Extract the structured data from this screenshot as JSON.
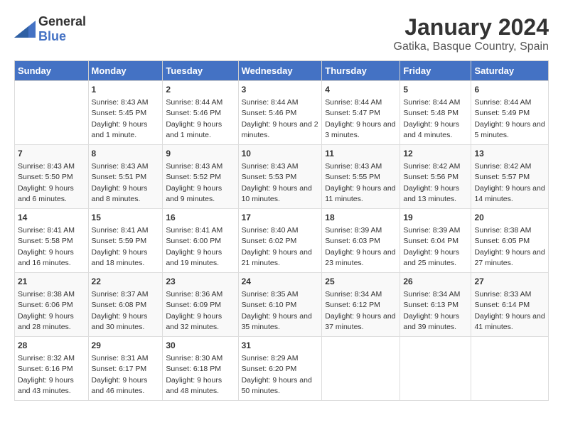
{
  "logo": {
    "general": "General",
    "blue": "Blue"
  },
  "title": "January 2024",
  "subtitle": "Gatika, Basque Country, Spain",
  "days_of_week": [
    "Sunday",
    "Monday",
    "Tuesday",
    "Wednesday",
    "Thursday",
    "Friday",
    "Saturday"
  ],
  "weeks": [
    [
      {
        "day": "",
        "sunrise": "",
        "sunset": "",
        "daylight": ""
      },
      {
        "day": "1",
        "sunrise": "Sunrise: 8:43 AM",
        "sunset": "Sunset: 5:45 PM",
        "daylight": "Daylight: 9 hours and 1 minute."
      },
      {
        "day": "2",
        "sunrise": "Sunrise: 8:44 AM",
        "sunset": "Sunset: 5:46 PM",
        "daylight": "Daylight: 9 hours and 1 minute."
      },
      {
        "day": "3",
        "sunrise": "Sunrise: 8:44 AM",
        "sunset": "Sunset: 5:46 PM",
        "daylight": "Daylight: 9 hours and 2 minutes."
      },
      {
        "day": "4",
        "sunrise": "Sunrise: 8:44 AM",
        "sunset": "Sunset: 5:47 PM",
        "daylight": "Daylight: 9 hours and 3 minutes."
      },
      {
        "day": "5",
        "sunrise": "Sunrise: 8:44 AM",
        "sunset": "Sunset: 5:48 PM",
        "daylight": "Daylight: 9 hours and 4 minutes."
      },
      {
        "day": "6",
        "sunrise": "Sunrise: 8:44 AM",
        "sunset": "Sunset: 5:49 PM",
        "daylight": "Daylight: 9 hours and 5 minutes."
      }
    ],
    [
      {
        "day": "7",
        "sunrise": "Sunrise: 8:43 AM",
        "sunset": "Sunset: 5:50 PM",
        "daylight": "Daylight: 9 hours and 6 minutes."
      },
      {
        "day": "8",
        "sunrise": "Sunrise: 8:43 AM",
        "sunset": "Sunset: 5:51 PM",
        "daylight": "Daylight: 9 hours and 8 minutes."
      },
      {
        "day": "9",
        "sunrise": "Sunrise: 8:43 AM",
        "sunset": "Sunset: 5:52 PM",
        "daylight": "Daylight: 9 hours and 9 minutes."
      },
      {
        "day": "10",
        "sunrise": "Sunrise: 8:43 AM",
        "sunset": "Sunset: 5:53 PM",
        "daylight": "Daylight: 9 hours and 10 minutes."
      },
      {
        "day": "11",
        "sunrise": "Sunrise: 8:43 AM",
        "sunset": "Sunset: 5:55 PM",
        "daylight": "Daylight: 9 hours and 11 minutes."
      },
      {
        "day": "12",
        "sunrise": "Sunrise: 8:42 AM",
        "sunset": "Sunset: 5:56 PM",
        "daylight": "Daylight: 9 hours and 13 minutes."
      },
      {
        "day": "13",
        "sunrise": "Sunrise: 8:42 AM",
        "sunset": "Sunset: 5:57 PM",
        "daylight": "Daylight: 9 hours and 14 minutes."
      }
    ],
    [
      {
        "day": "14",
        "sunrise": "Sunrise: 8:41 AM",
        "sunset": "Sunset: 5:58 PM",
        "daylight": "Daylight: 9 hours and 16 minutes."
      },
      {
        "day": "15",
        "sunrise": "Sunrise: 8:41 AM",
        "sunset": "Sunset: 5:59 PM",
        "daylight": "Daylight: 9 hours and 18 minutes."
      },
      {
        "day": "16",
        "sunrise": "Sunrise: 8:41 AM",
        "sunset": "Sunset: 6:00 PM",
        "daylight": "Daylight: 9 hours and 19 minutes."
      },
      {
        "day": "17",
        "sunrise": "Sunrise: 8:40 AM",
        "sunset": "Sunset: 6:02 PM",
        "daylight": "Daylight: 9 hours and 21 minutes."
      },
      {
        "day": "18",
        "sunrise": "Sunrise: 8:39 AM",
        "sunset": "Sunset: 6:03 PM",
        "daylight": "Daylight: 9 hours and 23 minutes."
      },
      {
        "day": "19",
        "sunrise": "Sunrise: 8:39 AM",
        "sunset": "Sunset: 6:04 PM",
        "daylight": "Daylight: 9 hours and 25 minutes."
      },
      {
        "day": "20",
        "sunrise": "Sunrise: 8:38 AM",
        "sunset": "Sunset: 6:05 PM",
        "daylight": "Daylight: 9 hours and 27 minutes."
      }
    ],
    [
      {
        "day": "21",
        "sunrise": "Sunrise: 8:38 AM",
        "sunset": "Sunset: 6:06 PM",
        "daylight": "Daylight: 9 hours and 28 minutes."
      },
      {
        "day": "22",
        "sunrise": "Sunrise: 8:37 AM",
        "sunset": "Sunset: 6:08 PM",
        "daylight": "Daylight: 9 hours and 30 minutes."
      },
      {
        "day": "23",
        "sunrise": "Sunrise: 8:36 AM",
        "sunset": "Sunset: 6:09 PM",
        "daylight": "Daylight: 9 hours and 32 minutes."
      },
      {
        "day": "24",
        "sunrise": "Sunrise: 8:35 AM",
        "sunset": "Sunset: 6:10 PM",
        "daylight": "Daylight: 9 hours and 35 minutes."
      },
      {
        "day": "25",
        "sunrise": "Sunrise: 8:34 AM",
        "sunset": "Sunset: 6:12 PM",
        "daylight": "Daylight: 9 hours and 37 minutes."
      },
      {
        "day": "26",
        "sunrise": "Sunrise: 8:34 AM",
        "sunset": "Sunset: 6:13 PM",
        "daylight": "Daylight: 9 hours and 39 minutes."
      },
      {
        "day": "27",
        "sunrise": "Sunrise: 8:33 AM",
        "sunset": "Sunset: 6:14 PM",
        "daylight": "Daylight: 9 hours and 41 minutes."
      }
    ],
    [
      {
        "day": "28",
        "sunrise": "Sunrise: 8:32 AM",
        "sunset": "Sunset: 6:16 PM",
        "daylight": "Daylight: 9 hours and 43 minutes."
      },
      {
        "day": "29",
        "sunrise": "Sunrise: 8:31 AM",
        "sunset": "Sunset: 6:17 PM",
        "daylight": "Daylight: 9 hours and 46 minutes."
      },
      {
        "day": "30",
        "sunrise": "Sunrise: 8:30 AM",
        "sunset": "Sunset: 6:18 PM",
        "daylight": "Daylight: 9 hours and 48 minutes."
      },
      {
        "day": "31",
        "sunrise": "Sunrise: 8:29 AM",
        "sunset": "Sunset: 6:20 PM",
        "daylight": "Daylight: 9 hours and 50 minutes."
      },
      {
        "day": "",
        "sunrise": "",
        "sunset": "",
        "daylight": ""
      },
      {
        "day": "",
        "sunrise": "",
        "sunset": "",
        "daylight": ""
      },
      {
        "day": "",
        "sunrise": "",
        "sunset": "",
        "daylight": ""
      }
    ]
  ]
}
